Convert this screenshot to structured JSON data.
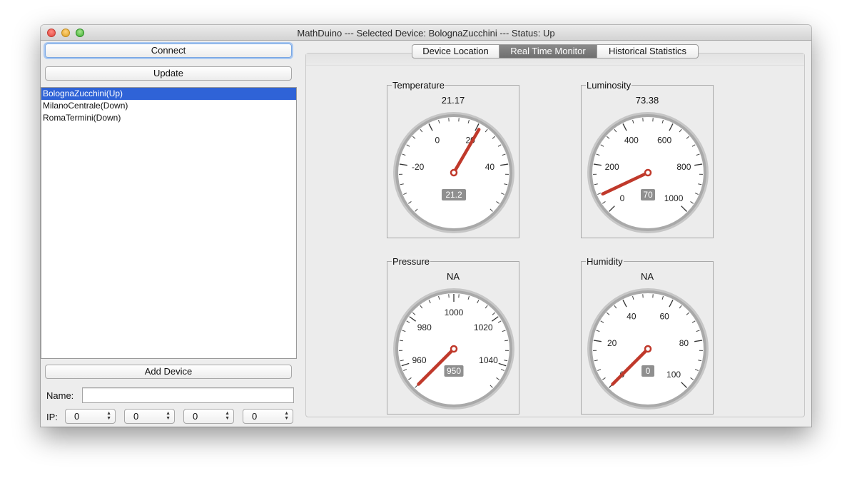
{
  "window": {
    "title": "MathDuino --- Selected Device: BolognaZucchini --- Status: Up"
  },
  "left": {
    "connect_label": "Connect",
    "update_label": "Update",
    "devices": [
      {
        "label": "BolognaZucchini(Up)",
        "selected": true
      },
      {
        "label": "MilanoCentrale(Down)",
        "selected": false
      },
      {
        "label": "RomaTermini(Down)",
        "selected": false
      }
    ],
    "add_device_label": "Add Device",
    "name_label": "Name:",
    "name_value": "",
    "ip_label": "IP:",
    "ip_octets": [
      "0",
      "0",
      "0",
      "0"
    ]
  },
  "tabs": [
    {
      "label": "Device Location",
      "active": false
    },
    {
      "label": "Real Time Monitor",
      "active": true
    },
    {
      "label": "Historical Statistics",
      "active": false
    }
  ],
  "gauges": [
    {
      "title": "Temperature",
      "value_text": "21.17",
      "badge": "21.2",
      "min": -40,
      "max": 60,
      "value": 21.17,
      "labels": [
        "-20",
        "0",
        "20",
        "40"
      ],
      "label_values": [
        -20,
        0,
        20,
        40
      ],
      "minor_step": 4
    },
    {
      "title": "Luminosity",
      "value_text": "73.38",
      "badge": "70",
      "min": 0,
      "max": 1000,
      "value": 73.38,
      "labels": [
        "0",
        "200",
        "400",
        "600",
        "800",
        "1000"
      ],
      "label_values": [
        0,
        200,
        400,
        600,
        800,
        1000
      ],
      "minor_step": 40
    },
    {
      "title": "Pressure",
      "value_text": "NA",
      "badge": "950",
      "min": 950,
      "max": 1050,
      "value": 950,
      "labels": [
        "960",
        "980",
        "1000",
        "1020",
        "1040"
      ],
      "label_values": [
        960,
        980,
        1000,
        1020,
        1040
      ],
      "minor_step": 4
    },
    {
      "title": "Humidity",
      "value_text": "NA",
      "badge": "0",
      "min": 0,
      "max": 100,
      "value": 0,
      "labels": [
        "0",
        "20",
        "40",
        "60",
        "80",
        "100"
      ],
      "label_values": [
        0,
        20,
        40,
        60,
        80,
        100
      ],
      "minor_step": 4
    }
  ],
  "colors": {
    "needle": "#c0392b",
    "selection": "#2f63d7",
    "badge": "#8f8f8f"
  }
}
